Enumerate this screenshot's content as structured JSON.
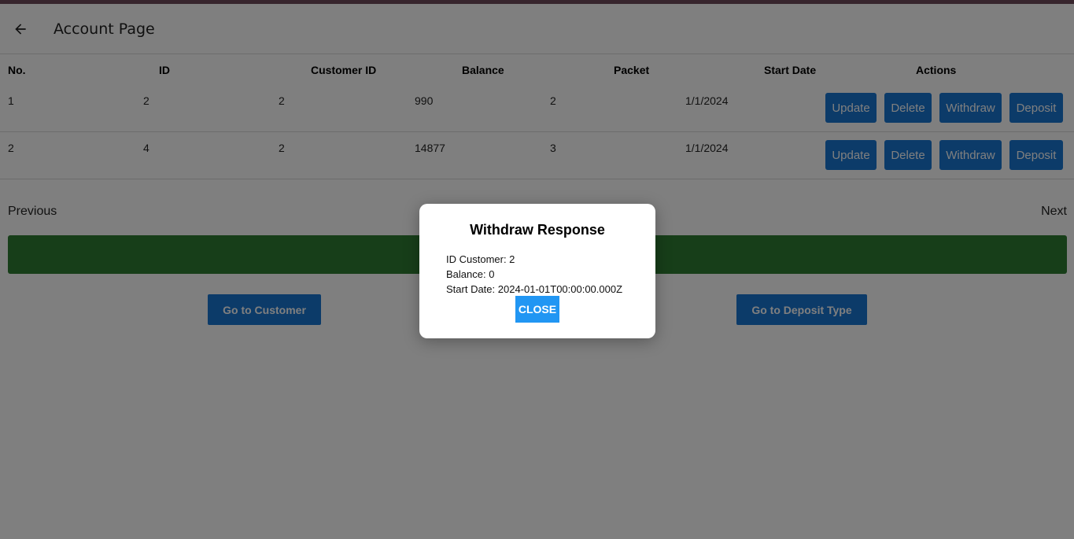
{
  "appbar": {
    "title": "Account Page",
    "back_icon": "arrow-left-icon"
  },
  "table": {
    "headers": [
      "No.",
      "ID",
      "Customer ID",
      "Balance",
      "Packet",
      "Start Date",
      "Actions"
    ],
    "rows": [
      {
        "no": "1",
        "id": "2",
        "customer_id": "2",
        "balance": "990",
        "packet": "2",
        "start_date": "1/1/2024"
      },
      {
        "no": "2",
        "id": "4",
        "customer_id": "2",
        "balance": "14877",
        "packet": "3",
        "start_date": "1/1/2024"
      }
    ],
    "actions": {
      "update": "Update",
      "delete": "Delete",
      "withdraw": "Withdraw",
      "deposit": "Deposit"
    }
  },
  "pagination": {
    "previous": "Previous",
    "next": "Next"
  },
  "nav": {
    "customer": "Go to Customer",
    "deposit_type": "Go to Deposit Type"
  },
  "dialog": {
    "title": "Withdraw Response",
    "line1": "ID Customer: 2",
    "line2": "Balance: 0",
    "line3": "Start Date: 2024-01-01T00:00:00.000Z",
    "close": "CLOSE"
  },
  "colors": {
    "primary": "#1976d2",
    "success": "#2e7d32",
    "dialog_button": "#2196f3",
    "top_strip": "#6f4b5b"
  }
}
